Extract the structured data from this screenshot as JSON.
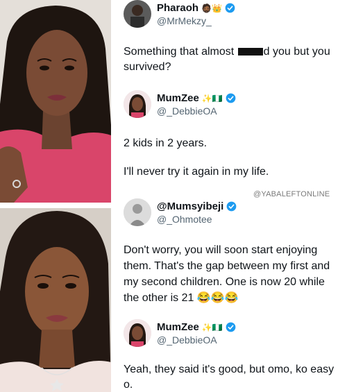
{
  "watermark": "@YABALEFTONLINE",
  "tweets": [
    {
      "display_name": "Pharaoh",
      "emojis": "🧔🏾👑",
      "handle": "@MrMekzy_",
      "text_before": "Something that almost ",
      "text_after": "d you but you survived?"
    },
    {
      "display_name": "MumZee",
      "emojis": "✨🇳🇬",
      "handle": "@_DebbieOA",
      "line1": "2 kids in 2 years.",
      "line2": "I'll never try it again in my life."
    },
    {
      "display_name": "@Mumsyibeji",
      "handle": "@_Ohmotee",
      "text": "Don't worry, you will soon start enjoying them. That's the gap between my first and my second children. One is now 20 while the other is 21 😂😂😂"
    },
    {
      "display_name": "MumZee",
      "emojis": "✨🇳🇬",
      "handle": "@_DebbieOA",
      "text": "Yeah, they said it's good, but omo, ko easy o."
    }
  ],
  "colors": {
    "verified": "#1d9bf0",
    "handle": "#536471",
    "text": "#0f1419"
  }
}
